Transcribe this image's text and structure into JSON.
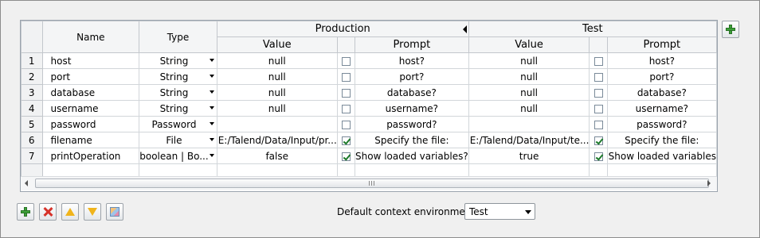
{
  "table": {
    "headers": {
      "name": "Name",
      "type": "Type",
      "groups": [
        "Production",
        "Test"
      ],
      "value": "Value",
      "prompt": "Prompt"
    },
    "rows": [
      {
        "num": "1",
        "name": "host",
        "type": "String",
        "prod": {
          "value": "null",
          "checked": false,
          "prompt": "host?"
        },
        "test": {
          "value": "null",
          "checked": false,
          "prompt": "host?"
        }
      },
      {
        "num": "2",
        "name": "port",
        "type": "String",
        "prod": {
          "value": "null",
          "checked": false,
          "prompt": "port?"
        },
        "test": {
          "value": "null",
          "checked": false,
          "prompt": "port?"
        }
      },
      {
        "num": "3",
        "name": "database",
        "type": "String",
        "prod": {
          "value": "null",
          "checked": false,
          "prompt": "database?"
        },
        "test": {
          "value": "null",
          "checked": false,
          "prompt": "database?"
        }
      },
      {
        "num": "4",
        "name": "username",
        "type": "String",
        "prod": {
          "value": "null",
          "checked": false,
          "prompt": "username?"
        },
        "test": {
          "value": "null",
          "checked": false,
          "prompt": "username?"
        }
      },
      {
        "num": "5",
        "name": "password",
        "type": "Password",
        "prod": {
          "value": "",
          "checked": false,
          "prompt": "password?"
        },
        "test": {
          "value": "",
          "checked": false,
          "prompt": "password?"
        }
      },
      {
        "num": "6",
        "name": "filename",
        "type": "File",
        "prod": {
          "value": "E:/Talend/Data/Input/pr...",
          "checked": true,
          "prompt": "Specify the file:"
        },
        "test": {
          "value": "E:/Talend/Data/Input/te...",
          "checked": true,
          "prompt": "Specify the file:"
        }
      },
      {
        "num": "7",
        "name": "printOperation",
        "type": "boolean | Bo...",
        "prod": {
          "value": "false",
          "checked": true,
          "prompt": "Show loaded variables?"
        },
        "test": {
          "value": "true",
          "checked": true,
          "prompt": "Show loaded variables"
        }
      }
    ],
    "scrollbar_grip": "III"
  },
  "footer": {
    "default_context_label": "Default context environment",
    "default_context_value": "Test"
  },
  "icons": {
    "add": "plus-icon",
    "remove": "delete-icon",
    "up": "move-up-icon",
    "down": "move-down-icon",
    "contexts": "manage-contexts-icon"
  },
  "colors": {
    "accent_green": "#3ea13a",
    "delete_red": "#d6322a",
    "arrow_yellow": "#f0b41c"
  }
}
